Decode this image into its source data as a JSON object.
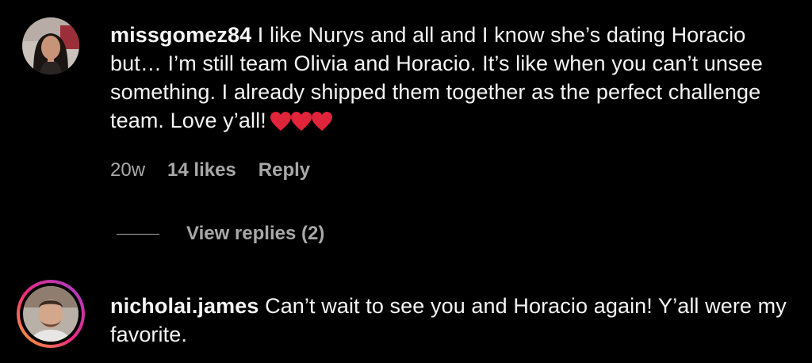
{
  "comments": [
    {
      "username": "missgomez84",
      "text": "I like Nurys and all and I know she’s dating Horacio but… I’m still team Olivia and Horacio. It’s like when you can’t unsee something. I already shipped them together as the perfect challenge team. Love y’all!",
      "emoji": [
        "red-heart",
        "red-heart",
        "red-heart"
      ],
      "age": "20w",
      "likes": "14 likes",
      "reply_label": "Reply",
      "view_replies": "View replies (2)"
    },
    {
      "username": "nicholai.james",
      "text": "Can’t wait to see you and Horacio again! Y’all were my favorite.",
      "has_story_ring": true
    }
  ],
  "colors": {
    "background": "#000000",
    "primary_text": "#f5f5f5",
    "secondary_text": "#a8a8a8",
    "heart": "#e0243a"
  }
}
